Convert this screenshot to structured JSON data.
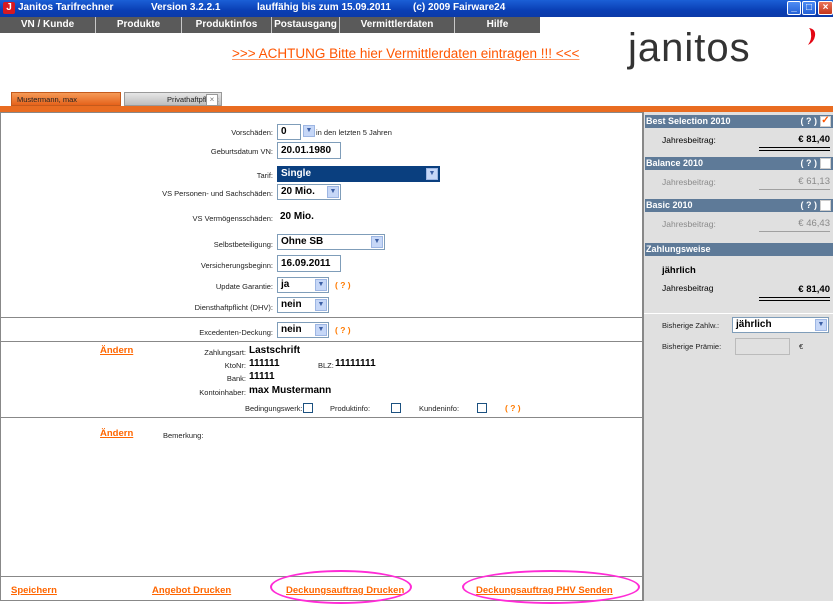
{
  "titlebar": {
    "app": "Janitos Tarifrechner",
    "version": "Version 3.2.2.1",
    "valid": "lauffähig bis zum 15.09.2011",
    "copyright": "(c) 2009 Fairware24"
  },
  "menu": [
    "VN / Kunde",
    "Produkte",
    "Produktinfos",
    "Postausgang",
    "Vermittlerdaten",
    "Hilfe"
  ],
  "banner": {
    "warning": ">>> ACHTUNG Bitte hier Vermittlerdaten eintragen !!! <<<",
    "logo": "janitos"
  },
  "tabs": [
    "Mustermann, max",
    "Privathaftpflicht"
  ],
  "form": {
    "vorschaeden_label": "Vorschäden:",
    "vorschaeden_value": "0",
    "vorschaeden_suffix": "in den letzten 5 Jahren",
    "geburtsdatum_label": "Geburtsdatum VN:",
    "geburtsdatum_value": "20.01.1980",
    "tarif_label": "Tarif:",
    "tarif_value": "Single",
    "vs_personen_label": "VS Personen- und Sachschäden:",
    "vs_personen_value": "20 Mio.",
    "vs_vermoegen_label": "VS Vermögensschäden:",
    "vs_vermoegen_value": "20 Mio.",
    "selbstbeteiligung_label": "Selbstbeteiligung:",
    "selbstbeteiligung_value": "Ohne SB",
    "versicherungsbeginn_label": "Versicherungsbeginn:",
    "versicherungsbeginn_value": "16.09.2011",
    "update_label": "Update Garantie:",
    "update_value": "ja",
    "dhv_label": "Diensthaftpflicht (DHV):",
    "dhv_value": "nein",
    "excedenten_label": "Excedenten-Deckung:",
    "excedenten_value": "nein",
    "help": "( ? )"
  },
  "payment": {
    "aendern": "Ändern",
    "zahlungsart_label": "Zahlungsart:",
    "zahlungsart_value": "Lastschrift",
    "ktonr_label": "KtoNr:",
    "ktonr_value": "111111",
    "blz_label": "BLZ:",
    "blz_value": "11111111",
    "bank_label": "Bank:",
    "bank_value": "11111",
    "inhaber_label": "Kontoinhaber:",
    "inhaber_value": "max Mustermann",
    "bedingungswerk": "Bedingungswerk:",
    "produktinfo": "Produktinfo:",
    "kundeninfo": "Kundeninfo:"
  },
  "remarks": {
    "aendern": "Ändern",
    "label": "Bemerkung:"
  },
  "footer": [
    "Speichern",
    "Angebot Drucken",
    "Deckungsauftrag Drucken",
    "Deckungsauftrag PHV Senden"
  ],
  "right": {
    "best": {
      "title": "Best Selection 2010",
      "q": "( ? )",
      "label": "Jahresbeitrag:",
      "amount": "€ 81,40",
      "checked": true
    },
    "balance": {
      "title": "Balance 2010",
      "q": "( ? )",
      "label": "Jahresbeitrag:",
      "amount": "€ 61,13",
      "checked": false
    },
    "basic": {
      "title": "Basic 2010",
      "q": "( ? )",
      "label": "Jahresbeitrag:",
      "amount": "€ 46,43",
      "checked": false
    },
    "zahlungsweise": {
      "title": "Zahlungsweise",
      "value": "jährlich",
      "label": "Jahresbeitrag",
      "amount": "€ 81,40"
    },
    "bisherige_zahlw_label": "Bisherige Zahlw.:",
    "bisherige_zahlw_value": "jährlich",
    "bisherige_praemie_label": "Bisherige Prämie:",
    "bisherige_praemie_unit": "€"
  },
  "colors": {
    "accent_orange": "#ff6600",
    "highlight_oval": "#ff2bd6",
    "right_header": "#5e7a98",
    "tarif_select": "#0a3f7f"
  }
}
